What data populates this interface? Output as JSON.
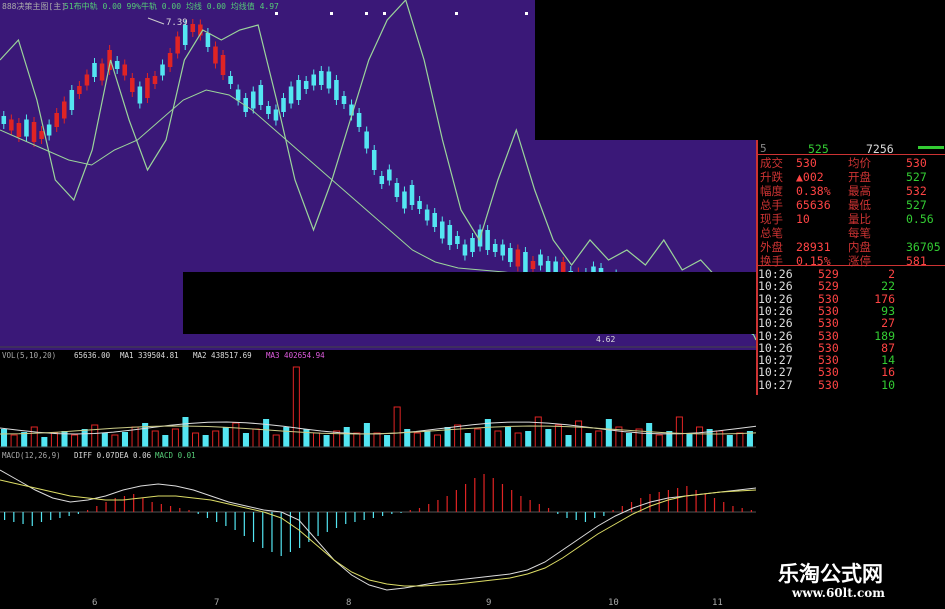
{
  "colors": {
    "bg": "#000000",
    "panel": "#3a1878",
    "up": "#e02424",
    "down": "#54e6f2",
    "line": "#9bd59b",
    "label": "#cc3333",
    "green": "#33cc33"
  },
  "main_chart": {
    "title": "888决策主图[主]",
    "legend": "51布中轨 0.00 99%牛轨 0.00 均线 0.00 均线值 4.97",
    "price_marker": "7.39",
    "low_marker": "4.62"
  },
  "quote": {
    "top": {
      "value_a": "525",
      "value_b": "7256"
    },
    "rows": [
      {
        "l": "成交",
        "v": "530",
        "l2": "均价",
        "v2": "530"
      },
      {
        "l": "升跌",
        "v": "▲002",
        "l2": "开盘",
        "v2": "527"
      },
      {
        "l": "幅度",
        "v": "0.38%",
        "l2": "最高",
        "v2": "532"
      },
      {
        "l": "总手",
        "v": "65636",
        "l2": "最低",
        "v2": "527"
      },
      {
        "l": "现手",
        "v": "10",
        "l2": "量比",
        "v2": "0.56"
      },
      {
        "l": "总笔",
        "v": "",
        "l2": "每笔",
        "v2": ""
      },
      {
        "l": "外盘",
        "v": "28931",
        "l2": "内盘",
        "v2": "36705"
      },
      {
        "l": "换手",
        "v": "0.15%",
        "l2": "涨停",
        "v2": "581"
      }
    ]
  },
  "ticks": [
    {
      "time": "10:26",
      "price": "529",
      "vol": "2"
    },
    {
      "time": "10:26",
      "price": "529",
      "vol": "22"
    },
    {
      "time": "10:26",
      "price": "530",
      "vol": "176"
    },
    {
      "time": "10:26",
      "price": "530",
      "vol": "93"
    },
    {
      "time": "10:26",
      "price": "530",
      "vol": "27"
    },
    {
      "time": "10:26",
      "price": "530",
      "vol": "189"
    },
    {
      "time": "10:26",
      "price": "530",
      "vol": "87"
    },
    {
      "time": "10:27",
      "price": "530",
      "vol": "14"
    },
    {
      "time": "10:27",
      "price": "530",
      "vol": "16"
    },
    {
      "time": "10:27",
      "price": "530",
      "vol": "10"
    }
  ],
  "volume_indicator": {
    "prefix": "VOL(5,10,20)",
    "vol": "65636.00",
    "ma1": "MA1 339504.81",
    "ma2": "MA2 438517.69",
    "ma3": "MA3 402654.94"
  },
  "macd_indicator": {
    "prefix": "MACD(12,26,9)",
    "diff": "DIFF 0.07",
    "dea": "DEA 0.06",
    "macd": "MACD 0.01"
  },
  "x_axis": [
    "6",
    "7",
    "8",
    "9",
    "10",
    "11"
  ],
  "watermark": {
    "title": "乐淘公式网",
    "url": "www.60lt.com"
  }
}
